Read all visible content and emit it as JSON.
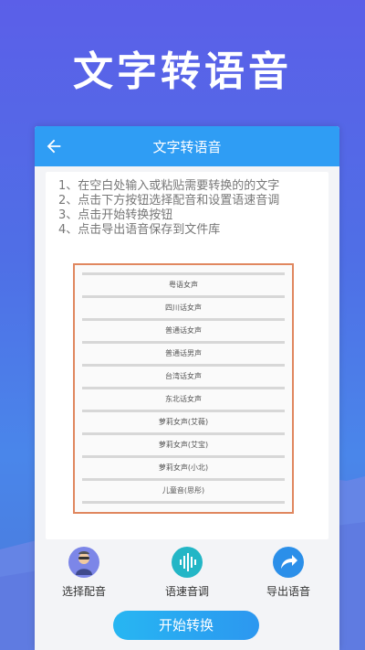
{
  "hero": {
    "title": "文字转语音"
  },
  "app": {
    "title": "文字转语音",
    "instructions": [
      "1、在空白处输入或粘贴需要转换的的文字",
      "2、点击下方按钮选择配音和设置语速音调",
      "3、点击开始转换按钮",
      "4、点击导出语音保存到文件库"
    ],
    "voices": [
      "粤语女声",
      "四川话女声",
      "普通话女声",
      "普通话男声",
      "台湾话女声",
      "东北话女声",
      "萝莉女声(艾薇)",
      "萝莉女声(艾宝)",
      "萝莉女声(小北)",
      "儿童音(思彤)"
    ],
    "tools": {
      "select_voice": "选择配音",
      "speed_pitch": "语速音调",
      "export": "导出语音"
    },
    "start_button": "开始转换"
  },
  "colors": {
    "app_bar": "#2f9df4",
    "border_accent": "#e0875f",
    "button_gradient_start": "#27b6f2",
    "button_gradient_end": "#2c97f0"
  },
  "icons": [
    "back-arrow-icon",
    "avatar-icon",
    "voice-wave-icon",
    "share-arrow-icon"
  ]
}
